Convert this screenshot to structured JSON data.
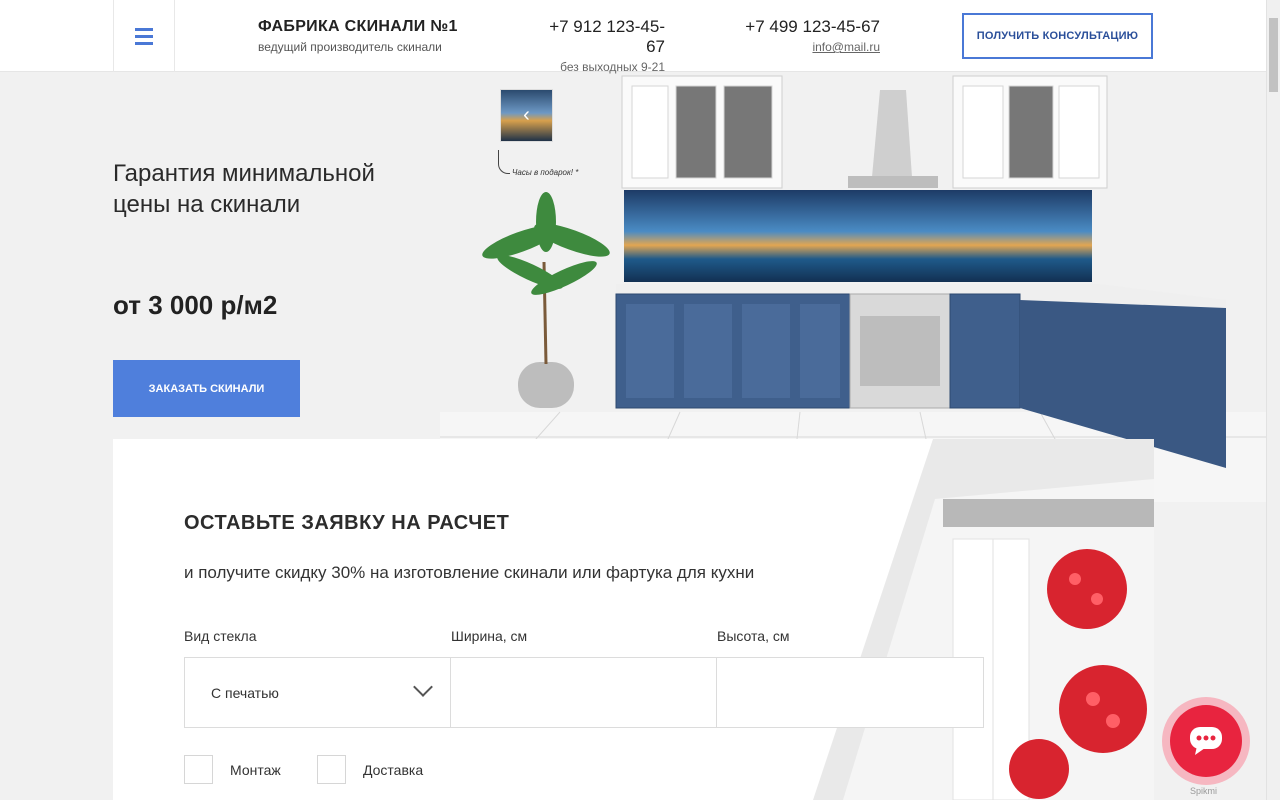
{
  "header": {
    "brand_title": "ФАБРИКА СКИНАЛИ №1",
    "brand_subtitle": "ведущий производитель скинали",
    "phone1": "+7 912 123-45-67",
    "phone1_note": "без выходных 9-21",
    "phone2": "+7 499 123-45-67",
    "email": "info@mail.ru",
    "consult_button": "ПОЛУЧИТЬ КОНСУЛЬТАЦИЮ"
  },
  "hero": {
    "title": "Гарантия минимальной цены на скинали",
    "price": "от 3 000 р/м2",
    "order_button": "ЗАКАЗАТЬ СКИНАЛИ",
    "gift_note": "Часы в подарок! *"
  },
  "form": {
    "title": "ОСТАВЬТЕ ЗАЯВКУ НА РАСЧЕТ",
    "subtitle": "и получите скидку 30% на изготовление скинали или фартука для кухни",
    "glass_label": "Вид стекла",
    "glass_value": "С печатью",
    "width_label": "Ширина, см",
    "height_label": "Высота, см",
    "option1": "Монтаж",
    "option2": "Доставка"
  },
  "chat": {
    "label": "Spikmi"
  },
  "colors": {
    "accent": "#4f7fdc",
    "chat": "#e8243f"
  }
}
